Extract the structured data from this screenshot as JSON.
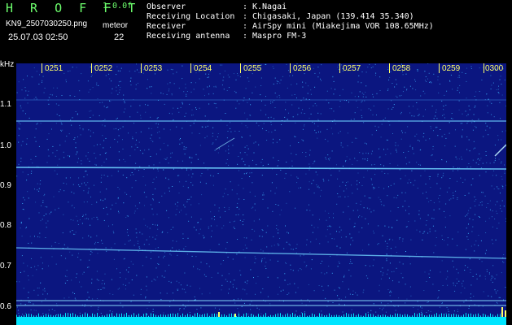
{
  "header": {
    "app_title": "H R O F F T",
    "version": "1.0.0f",
    "filename": "KN9_2507030250.png",
    "meteor_label": "meteor",
    "timestamp": "25.07.03 02:50",
    "meteor_count": "22"
  },
  "meta": [
    {
      "label": "Observer",
      "value": "K.Nagai"
    },
    {
      "label": "Receiving Location",
      "value": "Chigasaki, Japan (139.414 35.340)"
    },
    {
      "label": "Receiver",
      "value": "AirSpy mini (Miakejima VOR 108.65MHz)"
    },
    {
      "label": "Receiving antenna",
      "value": "Maspro FM-3"
    }
  ],
  "spectrogram": {
    "y_unit": "kHz",
    "y_ticks": [
      "1.1",
      "1.0",
      "0.9",
      "0.8",
      "0.7",
      "0.6"
    ],
    "x_ticks": [
      "0251",
      "0252",
      "0253",
      "0254",
      "0255",
      "0256",
      "0257",
      "0258",
      "0259",
      "0300"
    ],
    "colors": {
      "background": "#0b1680",
      "noise": "#3fb6ff",
      "signal": "#8ee3ff",
      "bottom_band": "#00e5ff",
      "timeline": "#ffff66"
    }
  }
}
